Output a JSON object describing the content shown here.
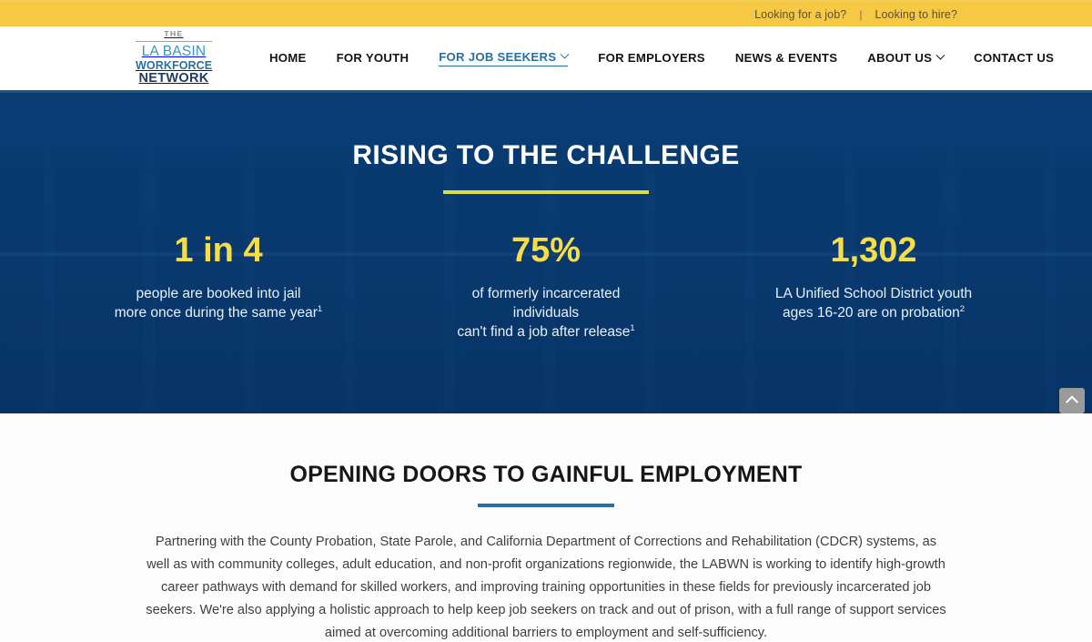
{
  "topbar": {
    "job_seeker_link": "Looking for a job?",
    "separator": "|",
    "employer_link": "Looking to hire?",
    "background_color": "#f6c944"
  },
  "logo": {
    "the": "THE",
    "line1": "LA BASIN",
    "line2": "WORKFORCE",
    "line3": "NETWORK",
    "color_line1": "#3c94c4",
    "color_line2": "#2a6fa3",
    "color_line3": "#1d3d63"
  },
  "nav": {
    "items": [
      {
        "label": "HOME",
        "active": false,
        "has_dropdown": false
      },
      {
        "label": "FOR YOUTH",
        "active": false,
        "has_dropdown": false
      },
      {
        "label": "FOR JOB SEEKERS",
        "active": true,
        "has_dropdown": true
      },
      {
        "label": "FOR EMPLOYERS",
        "active": false,
        "has_dropdown": false
      },
      {
        "label": "NEWS & EVENTS",
        "active": false,
        "has_dropdown": false
      },
      {
        "label": "ABOUT US",
        "active": false,
        "has_dropdown": true
      },
      {
        "label": "CONTACT US",
        "active": false,
        "has_dropdown": false
      }
    ],
    "active_color": "#2a6fa3"
  },
  "hero": {
    "title": "RISING TO THE CHALLENGE",
    "rule_color": "#d8df4a",
    "overlay_color": "#1a6c9e",
    "stats": [
      {
        "number": "1 in 4",
        "lines": [
          "people are booked into jail",
          "more once during the same year"
        ],
        "footnote": "1"
      },
      {
        "number": "75%",
        "lines": [
          "of formerly incarcerated",
          "individuals",
          "can't find a job after release"
        ],
        "footnote": "1"
      },
      {
        "number": "1,302",
        "lines": [
          "LA Unified School District youth",
          "ages 16-20 are on probation"
        ],
        "footnote": "2"
      }
    ],
    "number_color": "#f6dd4a"
  },
  "section": {
    "title": "OPENING DOORS TO GAINFUL EMPLOYMENT",
    "rule_color": "#2a6fa3",
    "body": "Partnering with the County Probation, State Parole, and California Department of Corrections and Rehabilitation (CDCR) systems, as well as with community colleges, adult education, and non-profit organizations regionwide, the LABWN is working to identify high-growth career pathways with demand for skilled workers, and improving training opportunities in these fields for previously incarcerated job seekers. We're also applying a holistic approach to help keep job seekers on track and out of prison, with a full range of support services aimed at overcoming additional barriers to employment and self-sufficiency."
  },
  "scroll_to_top": {
    "icon": "chevron-up-icon",
    "label": "Back to top"
  }
}
